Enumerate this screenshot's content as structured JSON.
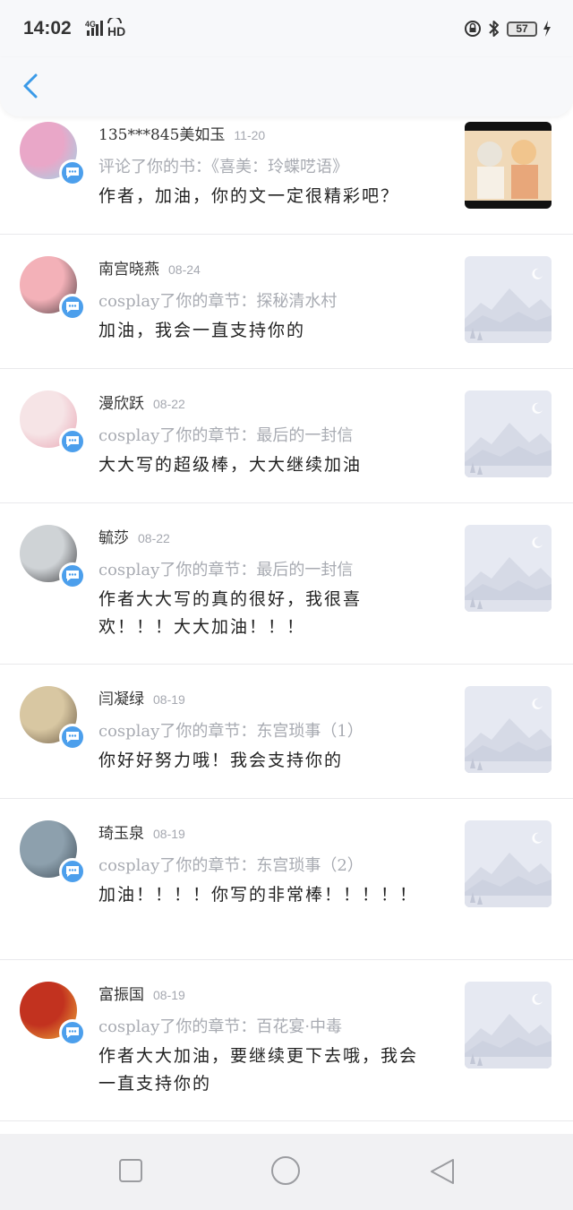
{
  "status_bar": {
    "time": "14:02",
    "network": "4G",
    "hd": "HD",
    "battery": "57"
  },
  "comments": [
    {
      "name": "135***845美如玉",
      "date": "11-20",
      "ref": "评论了你的书：《喜美：玲蝶呓语》",
      "text": "作者，加油，你的文一定很精彩吧？",
      "avatar_colors": [
        "#e9a7c8",
        "#9ad6e8"
      ],
      "thumb_type": "image"
    },
    {
      "name": "南宫晓燕",
      "date": "08-24",
      "ref": "cosplay了你的章节：探秘清水村",
      "text": "加油，我会一直支持你的",
      "avatar_colors": [
        "#f3b1b8",
        "#4a3a3e"
      ],
      "thumb_type": "placeholder"
    },
    {
      "name": "漫欣跃",
      "date": "08-22",
      "ref": "cosplay了你的章节：最后的一封信",
      "text": "大大写的超级棒，大大继续加油",
      "avatar_colors": [
        "#f6e4e6",
        "#e8a3b2"
      ],
      "thumb_type": "placeholder"
    },
    {
      "name": "毓莎",
      "date": "08-22",
      "ref": "cosplay了你的章节：最后的一封信",
      "text": "作者大大写的真的很好，我很喜欢！！！大大加油！！！",
      "avatar_colors": [
        "#cfd3d6",
        "#3b3b3e"
      ],
      "thumb_type": "placeholder"
    },
    {
      "name": "闫凝绿",
      "date": "08-19",
      "ref": "cosplay了你的章节：东宫琐事（1）",
      "text": "你好好努力哦！我会支持你的",
      "avatar_colors": [
        "#d8c7a2",
        "#6b5a44"
      ],
      "thumb_type": "placeholder"
    },
    {
      "name": "琦玉泉",
      "date": "08-19",
      "ref": "cosplay了你的章节：东宫琐事（2）",
      "text": "加油！！！！你写的非常棒！！！！！",
      "avatar_colors": [
        "#8da0ad",
        "#3e4c57"
      ],
      "thumb_type": "placeholder"
    },
    {
      "name": "富振国",
      "date": "08-19",
      "ref": "cosplay了你的章节：百花宴·中毒",
      "text": "作者大大加油，要继续更下去哦，我会一直支持你的",
      "avatar_colors": [
        "#c2321f",
        "#f0b23a"
      ],
      "thumb_type": "placeholder"
    }
  ],
  "colors": {
    "accent": "#4c9fec",
    "placeholder_bg": "#e6e9f2"
  }
}
